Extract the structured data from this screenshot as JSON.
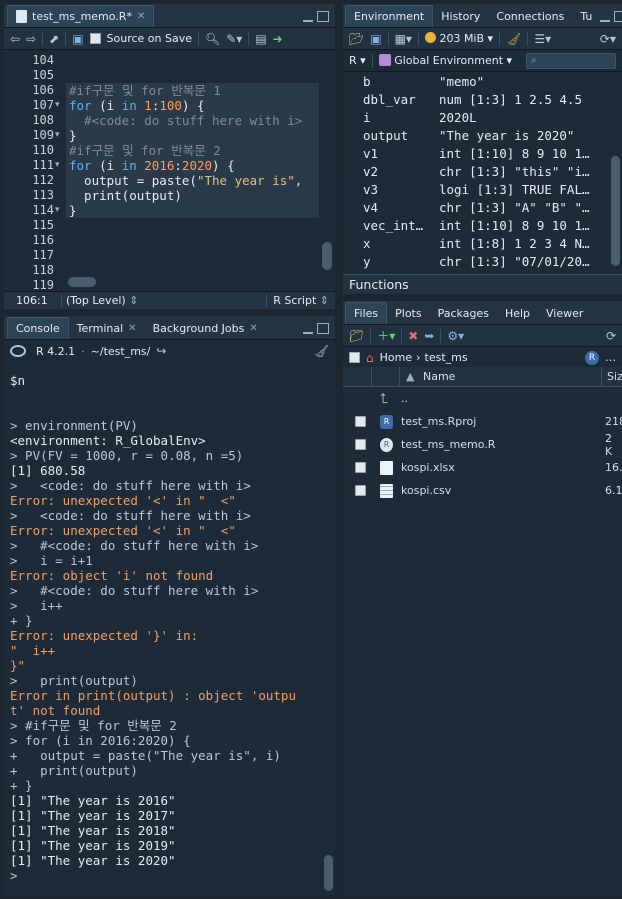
{
  "editor": {
    "tab_title": "test_ms_memo.R*",
    "toolbar": {
      "source_on_save": "Source on Save",
      "run": "Run"
    },
    "lines": [
      {
        "n": "104",
        "parts": []
      },
      {
        "n": "105",
        "parts": []
      },
      {
        "n": "106",
        "fold": false,
        "hl": true,
        "parts": [
          {
            "c": "cm",
            "t": "#if구문 및 for 반복문 1"
          }
        ]
      },
      {
        "n": "107",
        "fold": true,
        "hl": true,
        "parts": [
          {
            "c": "kw",
            "t": "for"
          },
          {
            "c": "fn",
            "t": " ("
          },
          {
            "c": "fn",
            "t": "i "
          },
          {
            "c": "kw",
            "t": "in"
          },
          {
            "c": "fn",
            "t": " "
          },
          {
            "c": "num",
            "t": "1"
          },
          {
            "c": "fn",
            "t": ":"
          },
          {
            "c": "num",
            "t": "100"
          },
          {
            "c": "fn",
            "t": ") {"
          }
        ]
      },
      {
        "n": "108",
        "hl": true,
        "parts": [
          {
            "c": "cm",
            "t": "  #<code: do stuff here with i>"
          }
        ]
      },
      {
        "n": "109",
        "fold": true,
        "hl": true,
        "parts": [
          {
            "c": "fn",
            "t": "}"
          }
        ]
      },
      {
        "n": "110",
        "hl": true,
        "parts": [
          {
            "c": "cm",
            "t": "#if구문 및 for 반복문 2"
          }
        ]
      },
      {
        "n": "111",
        "fold": true,
        "hl": true,
        "parts": [
          {
            "c": "kw",
            "t": "for"
          },
          {
            "c": "fn",
            "t": " (i "
          },
          {
            "c": "kw",
            "t": "in"
          },
          {
            "c": "fn",
            "t": " "
          },
          {
            "c": "num",
            "t": "2016"
          },
          {
            "c": "fn",
            "t": ":"
          },
          {
            "c": "num",
            "t": "2020"
          },
          {
            "c": "fn",
            "t": ") {"
          }
        ]
      },
      {
        "n": "112",
        "hl": true,
        "parts": [
          {
            "c": "fn",
            "t": "  output = paste("
          },
          {
            "c": "str",
            "t": "\"The year is\""
          },
          {
            "c": "fn",
            "t": ","
          }
        ]
      },
      {
        "n": "113",
        "hl": true,
        "parts": [
          {
            "c": "fn",
            "t": "  print(output)"
          }
        ]
      },
      {
        "n": "114",
        "fold": true,
        "hl": true,
        "parts": [
          {
            "c": "fn",
            "t": "}"
          }
        ]
      },
      {
        "n": "115",
        "parts": []
      },
      {
        "n": "116",
        "parts": []
      },
      {
        "n": "117",
        "parts": []
      },
      {
        "n": "118",
        "parts": []
      },
      {
        "n": "119",
        "parts": []
      }
    ],
    "status": {
      "position": "106:1",
      "scope": "(Top Level)",
      "filetype": "R Script"
    }
  },
  "console": {
    "tabs": [
      "Console",
      "Terminal",
      "Background Jobs"
    ],
    "r_version": "R 4.2.1",
    "path": "~/test_ms/",
    "lines": [
      {
        "c": "",
        "t": "$n"
      },
      {
        "c": "",
        "t": ""
      },
      {
        "c": "",
        "t": ""
      },
      {
        "c": "prompt",
        "t": "> environment(PV)"
      },
      {
        "c": "",
        "t": "<environment: R_GlobalEnv>"
      },
      {
        "c": "prompt",
        "t": "> PV(FV = 1000, r = 0.08, n =5)"
      },
      {
        "c": "",
        "t": "[1] 680.58"
      },
      {
        "c": "prompt",
        "t": ">   <code: do stuff here with i>"
      },
      {
        "c": "err",
        "t": "Error: unexpected '<' in \"  <\""
      },
      {
        "c": "prompt",
        "t": ">   <code: do stuff here with i>"
      },
      {
        "c": "err",
        "t": "Error: unexpected '<' in \"  <\""
      },
      {
        "c": "prompt",
        "t": ">   #<code: do stuff here with i>"
      },
      {
        "c": "prompt",
        "t": ">   i = i+1"
      },
      {
        "c": "err",
        "t": "Error: object 'i' not found"
      },
      {
        "c": "prompt",
        "t": ">   #<code: do stuff here with i>"
      },
      {
        "c": "prompt",
        "t": ">   i++"
      },
      {
        "c": "prompt",
        "t": "+ }"
      },
      {
        "c": "err",
        "t": "Error: unexpected '}' in:"
      },
      {
        "c": "err",
        "t": "\"  i++"
      },
      {
        "c": "err",
        "t": "}\""
      },
      {
        "c": "prompt",
        "t": ">   print(output)"
      },
      {
        "c": "err",
        "t": "Error in print(output) : object 'outpu"
      },
      {
        "c": "err",
        "t": "t' not found"
      },
      {
        "c": "prompt",
        "t": "> #if구문 및 for 반복문 2"
      },
      {
        "c": "prompt",
        "t": "> for (i in 2016:2020) {"
      },
      {
        "c": "prompt",
        "t": "+   output = paste(\"The year is\", i)"
      },
      {
        "c": "prompt",
        "t": "+   print(output)"
      },
      {
        "c": "prompt",
        "t": "+ }"
      },
      {
        "c": "",
        "t": "[1] \"The year is 2016\""
      },
      {
        "c": "",
        "t": "[1] \"The year is 2017\""
      },
      {
        "c": "",
        "t": "[1] \"The year is 2018\""
      },
      {
        "c": "",
        "t": "[1] \"The year is 2019\""
      },
      {
        "c": "",
        "t": "[1] \"The year is 2020\""
      },
      {
        "c": "prompt",
        "t": ">"
      }
    ]
  },
  "environment": {
    "tabs": [
      "Environment",
      "History",
      "Connections",
      "Tu"
    ],
    "memory": "203 MiB",
    "lang": "R",
    "scope": "Global Environment",
    "rows": [
      {
        "name": "b",
        "value": "\"memo\""
      },
      {
        "name": "dbl_var",
        "value": "num [1:3] 1 2.5 4.5"
      },
      {
        "name": "i",
        "value": "2020L"
      },
      {
        "name": "output",
        "value": "\"The year is 2020\""
      },
      {
        "name": "v1",
        "value": "int [1:10] 8 9 10 1…"
      },
      {
        "name": "v2",
        "value": "chr [1:3] \"this\" \"i…"
      },
      {
        "name": "v3",
        "value": "logi [1:3] TRUE FAL…"
      },
      {
        "name": "v4",
        "value": "chr [1:3] \"A\" \"B\" \"…"
      },
      {
        "name": "vec_int…",
        "value": "int [1:10] 8 9 10 1…"
      },
      {
        "name": "x",
        "value": "int [1:8] 1 2 3 4 N…"
      },
      {
        "name": "y",
        "value": "chr [1:3] \"07/01/20…"
      }
    ],
    "section": "Functions"
  },
  "files": {
    "tabs": [
      "Files",
      "Plots",
      "Packages",
      "Help",
      "Viewer"
    ],
    "breadcrumb": [
      "Home",
      "test_ms"
    ],
    "col_name": "Name",
    "col_size": "Siz",
    "up": "..",
    "items": [
      {
        "name": "test_ms.Rproj",
        "size": "218",
        "icon": "rproj-icon"
      },
      {
        "name": "test_ms_memo.R",
        "size": "2 K",
        "icon": "r-file-icon"
      },
      {
        "name": "kospi.xlsx",
        "size": "16.",
        "icon": "document-icon"
      },
      {
        "name": "kospi.csv",
        "size": "6.1",
        "icon": "csv-icon"
      }
    ]
  }
}
